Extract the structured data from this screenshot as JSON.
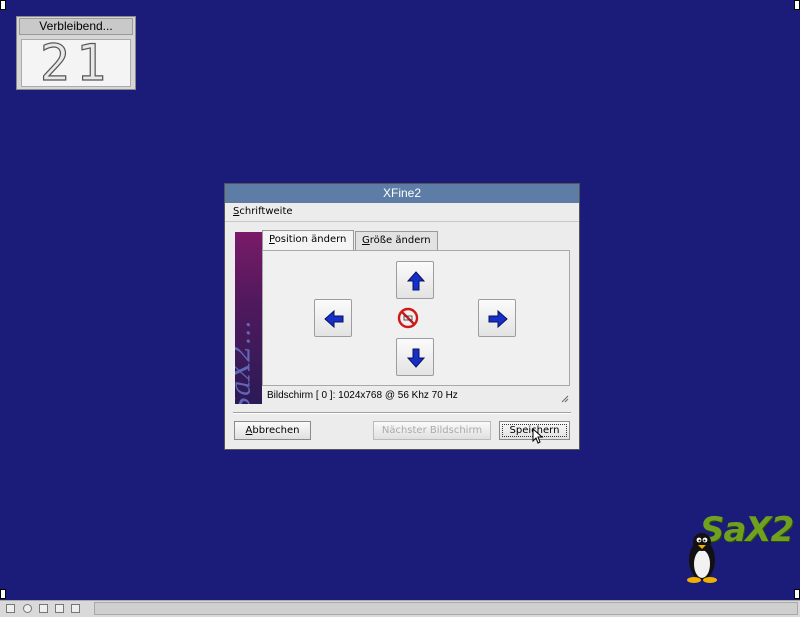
{
  "countdown": {
    "title": "Verbleibend...",
    "value": "21"
  },
  "dialog": {
    "title": "XFine2",
    "menu": {
      "label_prefix": "S",
      "label_rest": "chriftweite"
    },
    "banner_text": "SaX2...",
    "tabs": [
      {
        "u": "P",
        "rest": "osition ändern",
        "active": true
      },
      {
        "u": "G",
        "rest": "röße ändern",
        "active": false
      }
    ],
    "arrows": [
      "arrow-up-icon",
      "arrow-down-icon",
      "arrow-left-icon",
      "arrow-right-icon"
    ],
    "center_icon": "no-entry-icon",
    "status": "Bildschirm [ 0 ]: 1024x768 @ 56 Khz  70 Hz",
    "buttons": {
      "cancel": {
        "u": "A",
        "rest": "bbrechen"
      },
      "next": "Nächster Bildschirm",
      "save": "Speichern"
    }
  },
  "logo": {
    "text": "SaX2"
  },
  "colors": {
    "desktop": "#1b1b7a",
    "titlebar": "#5d7da6",
    "arrow": "#1530c8",
    "logo_green": "#6fa020"
  }
}
